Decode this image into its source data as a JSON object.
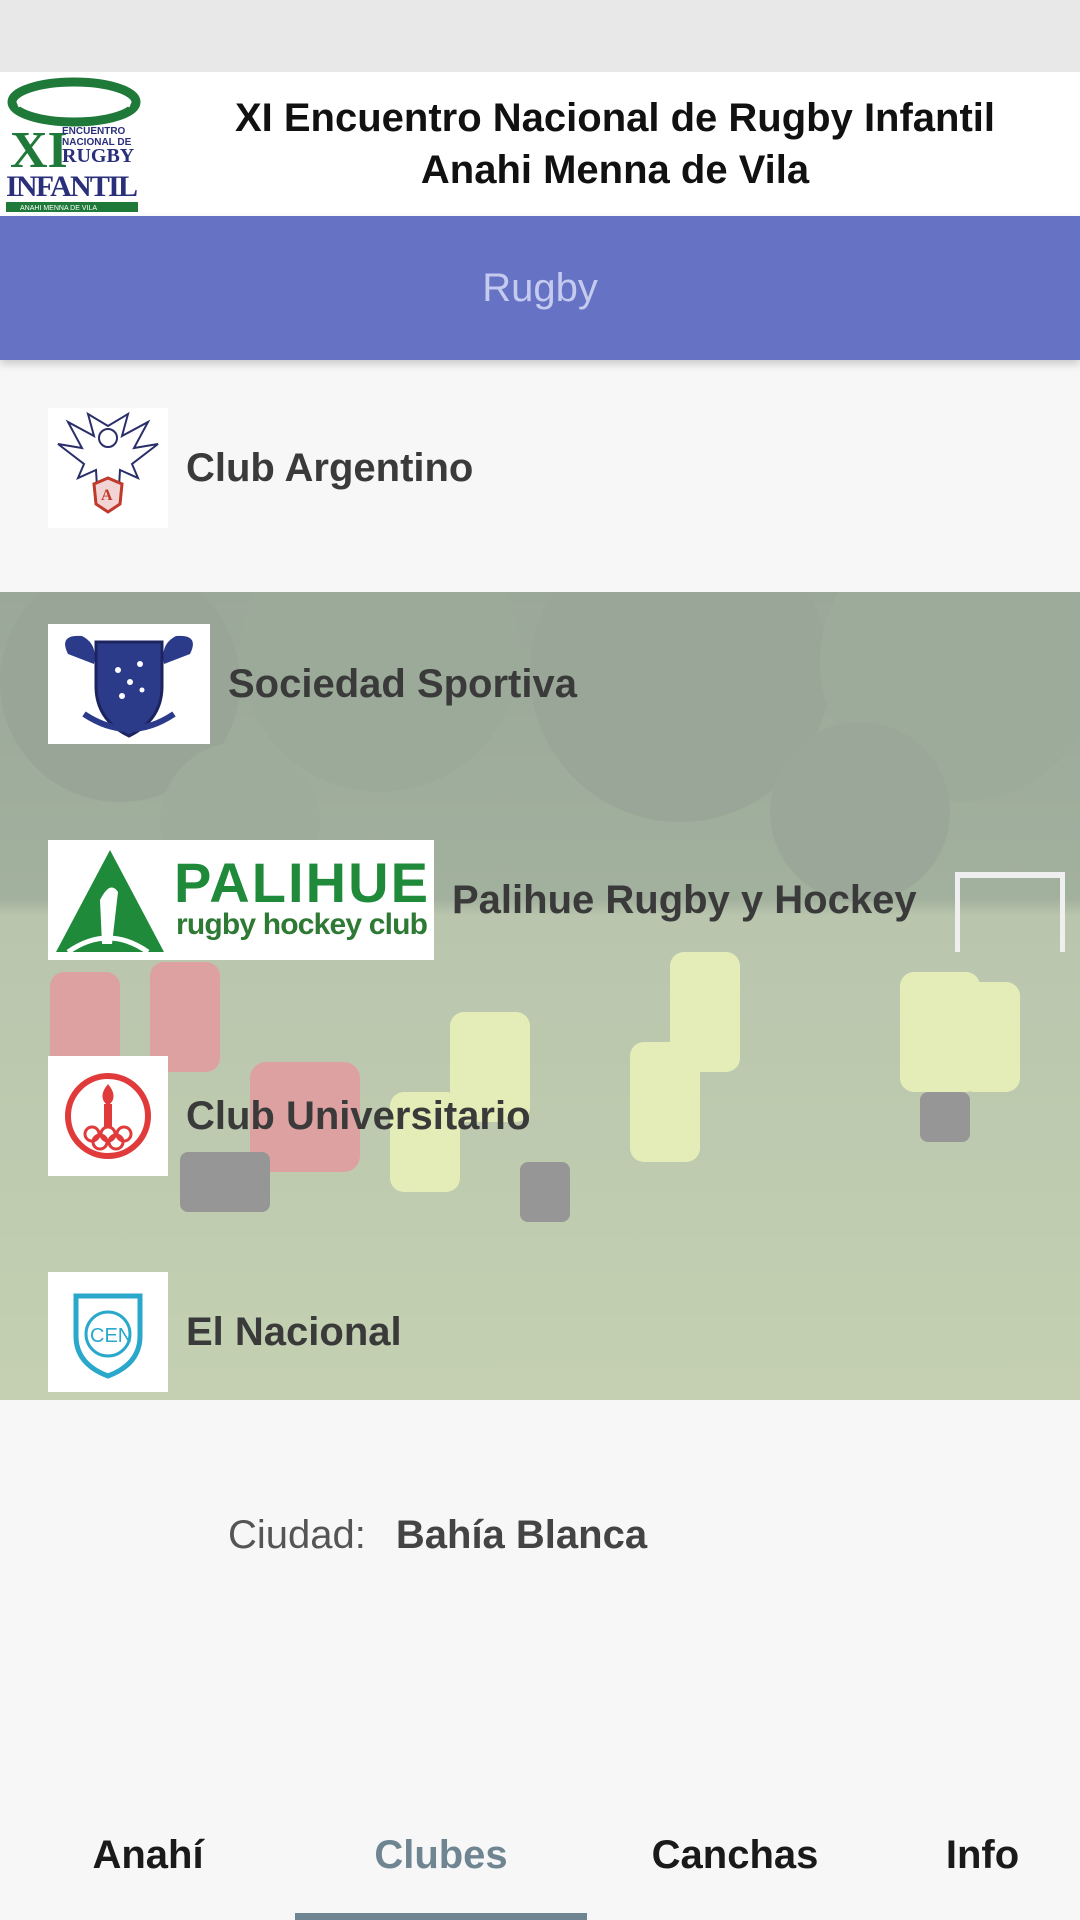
{
  "header": {
    "title_line1": "XI Encuentro Nacional de Rugby Infantil",
    "title_line2": "Anahi Menna de Vila"
  },
  "logo": {
    "roman": "XI",
    "line_a": "ENCUENTRO",
    "line_b": "NACIONAL DE",
    "line_c": "RUGBY",
    "word": "INFANTIL",
    "footer": "ANAHI MENNA DE VILA"
  },
  "category": {
    "label": "Rugby",
    "color": "#6672c4"
  },
  "clubs": [
    {
      "name": "Club Argentino",
      "logo_icon": "eagle-crest-icon"
    },
    {
      "name": "Sociedad Sportiva",
      "logo_icon": "shield-crest-icon"
    },
    {
      "name": "Palihue Rugby y Hockey",
      "logo_icon": "palihue-logo",
      "logo_text": "PALIHUE",
      "logo_subtext": "rugby hockey club"
    },
    {
      "name": "Club Universitario",
      "logo_icon": "torch-rings-icon"
    },
    {
      "name": "El Nacional",
      "logo_icon": "cen-shield-icon",
      "logo_text": "CEN"
    }
  ],
  "city": {
    "label": "Ciudad:",
    "value": "Bahía Blanca"
  },
  "tabs": [
    {
      "label": "Anahí",
      "active": false
    },
    {
      "label": "Clubes",
      "active": true
    },
    {
      "label": "Canchas",
      "active": false
    },
    {
      "label": "Info",
      "active": false
    }
  ],
  "colors": {
    "accent": "#6672c4",
    "active_tab": "#6f8592",
    "palihue_green": "#1e8a3a"
  }
}
